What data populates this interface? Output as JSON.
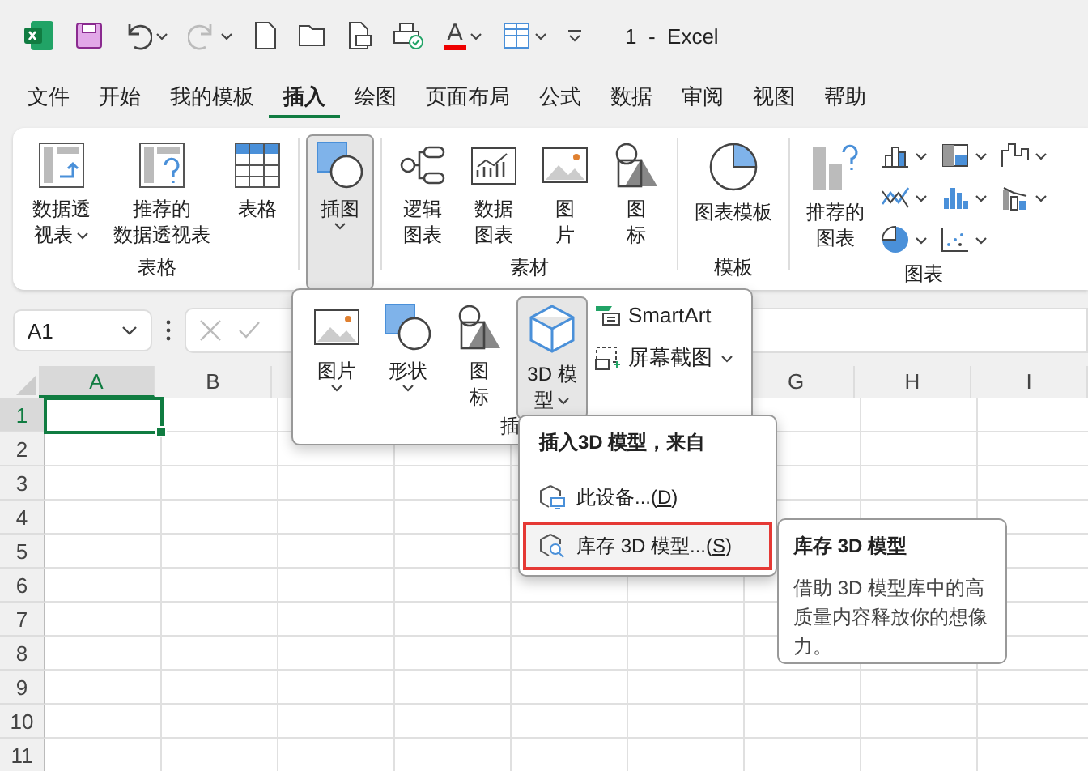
{
  "window": {
    "title": "1  -  Excel"
  },
  "quick_access": {
    "font_color_glyph": "A",
    "redo": {
      "disabled": true
    }
  },
  "tabs": [
    {
      "label": "文件",
      "selected": false
    },
    {
      "label": "开始",
      "selected": false
    },
    {
      "label": "我的模板",
      "selected": false
    },
    {
      "label": "插入",
      "selected": true
    },
    {
      "label": "绘图",
      "selected": false
    },
    {
      "label": "页面布局",
      "selected": false
    },
    {
      "label": "公式",
      "selected": false
    },
    {
      "label": "数据",
      "selected": false
    },
    {
      "label": "审阅",
      "selected": false
    },
    {
      "label": "视图",
      "selected": false
    },
    {
      "label": "帮助",
      "selected": false
    }
  ],
  "ribbon": {
    "groups": [
      {
        "label": "表格",
        "buttons": [
          {
            "kind": "pivot",
            "lines": [
              "数据透",
              "视表"
            ],
            "dropdown": true,
            "pressed": false
          },
          {
            "kind": "recommended-pivot",
            "lines": [
              "推荐的",
              "数据透视表"
            ],
            "dropdown": false,
            "pressed": false
          },
          {
            "kind": "table",
            "lines": [
              "表格"
            ],
            "dropdown": false,
            "pressed": false
          }
        ]
      },
      {
        "buttons": [
          {
            "kind": "illustrations",
            "lines": [
              "插图"
            ],
            "dropdown": true,
            "pressed": true
          }
        ]
      },
      {
        "label": "素材",
        "buttons": [
          {
            "kind": "diagram",
            "lines": [
              "逻辑",
              "图表"
            ],
            "dropdown": false,
            "pressed": false
          },
          {
            "kind": "data-chart",
            "lines": [
              "数据",
              "图表"
            ],
            "dropdown": false,
            "pressed": false
          },
          {
            "kind": "picture",
            "lines": [
              "图",
              "片"
            ],
            "dropdown": false,
            "pressed": false
          },
          {
            "kind": "icons",
            "lines": [
              "图",
              "标"
            ],
            "dropdown": false,
            "pressed": false
          }
        ]
      },
      {
        "label": "模板",
        "buttons": [
          {
            "kind": "chart-template",
            "lines": [
              "图表模板"
            ],
            "dropdown": false,
            "pressed": false
          }
        ]
      },
      {
        "label": "图表",
        "buttons": [
          {
            "kind": "recommended-chart",
            "lines": [
              "推荐的",
              "图表"
            ],
            "dropdown": false,
            "pressed": false
          }
        ],
        "small_buttons": [
          {
            "kind": "column"
          },
          {
            "kind": "line"
          },
          {
            "kind": "pie"
          },
          {
            "kind": "treemap"
          },
          {
            "kind": "histogram"
          },
          {
            "kind": "scatter"
          },
          {
            "kind": "waterfall"
          },
          {
            "kind": "combo"
          }
        ]
      }
    ]
  },
  "name_box": {
    "value": "A1"
  },
  "grid": {
    "columns_left": [
      {
        "label": "A",
        "selected": true
      },
      {
        "label": "B",
        "selected": false
      }
    ],
    "columns_right": [
      {
        "label": "G",
        "selected": false
      },
      {
        "label": "H",
        "selected": false
      },
      {
        "label": "I",
        "selected": false
      }
    ],
    "rows": [
      {
        "label": "1",
        "selected": true
      },
      {
        "label": "2",
        "selected": false
      },
      {
        "label": "3",
        "selected": false
      },
      {
        "label": "4",
        "selected": false
      },
      {
        "label": "5",
        "selected": false
      },
      {
        "label": "6",
        "selected": false
      },
      {
        "label": "7",
        "selected": false
      },
      {
        "label": "8",
        "selected": false
      },
      {
        "label": "9",
        "selected": false
      },
      {
        "label": "10",
        "selected": false
      },
      {
        "label": "11",
        "selected": false
      }
    ]
  },
  "illustrations_menu": {
    "group_label": "插",
    "items": [
      {
        "kind": "picture",
        "lines": [
          "图片"
        ],
        "dropdown": true,
        "pressed": false
      },
      {
        "kind": "shape",
        "lines": [
          "形状"
        ],
        "dropdown": true,
        "pressed": false
      },
      {
        "kind": "icons",
        "lines": [
          "图",
          "标"
        ],
        "dropdown": false,
        "pressed": false
      },
      {
        "kind": "model3d",
        "lines": [
          "3D 模",
          "型"
        ],
        "dropdown": true,
        "pressed": true
      }
    ],
    "side_items": [
      {
        "kind": "smartart",
        "label": "SmartArt",
        "dropdown": false
      },
      {
        "kind": "screenshot",
        "label": "屏幕截图",
        "dropdown": true
      }
    ]
  },
  "model_menu": {
    "heading": "插入3D 模型，来自",
    "items": [
      {
        "kind": "device",
        "label": "此设备...(",
        "access_key": "D",
        "label_end": ")",
        "highlighted": false
      },
      {
        "kind": "stock",
        "label": "库存 3D 模型...(",
        "access_key": "S",
        "label_end": ")",
        "highlighted": true
      }
    ]
  },
  "tooltip": {
    "title": "库存 3D 模型",
    "body": "借助 3D 模型库中的高质量内容释放你的想像力。"
  }
}
